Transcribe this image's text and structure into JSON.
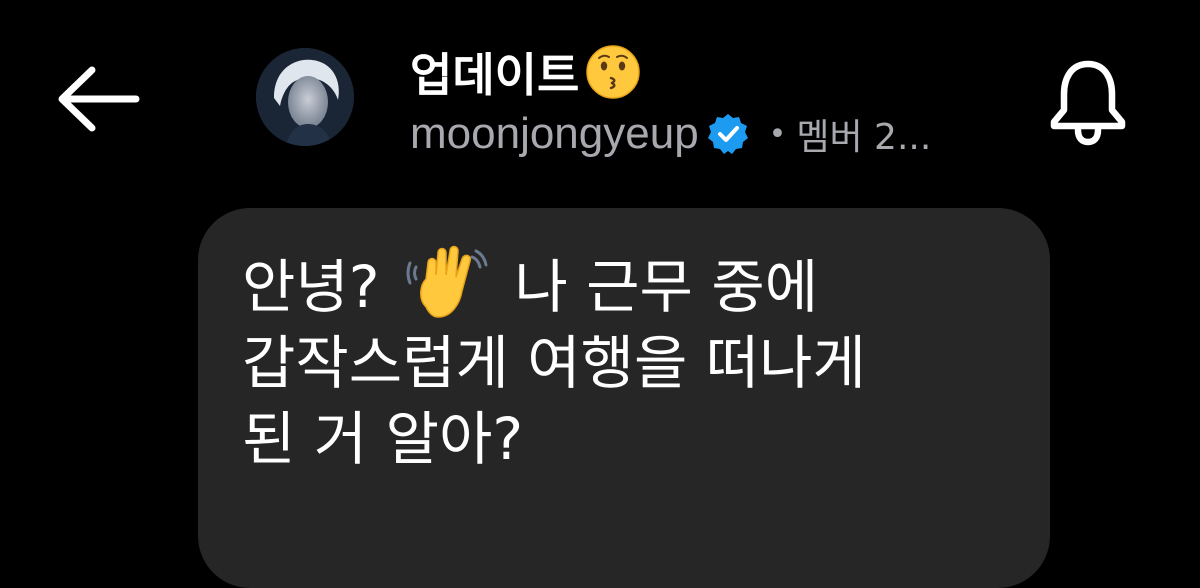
{
  "header": {
    "title": "업데이트",
    "title_emoji": "kissing-face-icon",
    "handle": "moonjongyeup",
    "verified_icon": "verified-badge-icon",
    "separator": "•",
    "members_text": "멤버 2..."
  },
  "nav": {
    "back_icon": "arrow-left-icon",
    "bell_icon": "bell-icon"
  },
  "message": {
    "line1_a": "안녕?",
    "line1_emoji": "waving-hand-icon",
    "line1_b": "나 근무 중에",
    "line2": "갑작스럽게 여행을 떠나게",
    "line3": "된 거 알아?"
  },
  "colors": {
    "background": "#000000",
    "bubble": "#262626",
    "secondary_text": "#a7a9ae",
    "verified_blue": "#1d9bf0",
    "emoji_yellow": "#ffc83d"
  }
}
